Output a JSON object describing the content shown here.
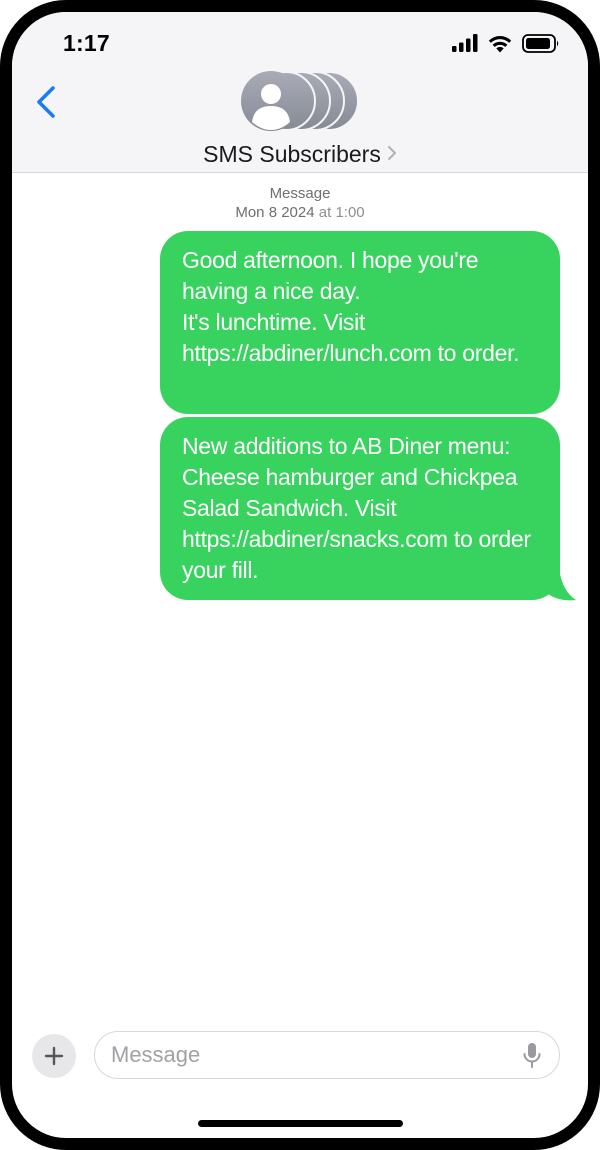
{
  "status_bar": {
    "time": "1:17",
    "icons": [
      "cellular-signal-icon",
      "wifi-icon",
      "battery-icon"
    ]
  },
  "header": {
    "back_icon": "chevron-left-icon",
    "avatar_icon": "group-avatar-icon",
    "contact_name": "SMS Subscribers",
    "contact_chevron": "chevron-right-icon"
  },
  "conversation": {
    "timestamp": {
      "label": "Message",
      "date": "Mon 8 2024",
      "at": "at",
      "time": "1:00"
    },
    "messages": [
      {
        "direction": "outgoing",
        "text": "Good afternoon. I hope you're having a nice day.\nIt's lunchtime. Visit https://abdiner/lunch.com to order."
      },
      {
        "direction": "outgoing",
        "text": "New additions to AB Diner menu: Cheese hamburger and Chickpea Salad Sandwich. Visit https://abdiner/snacks.com to order your fill."
      }
    ]
  },
  "composer": {
    "plus_icon": "plus-icon",
    "input_placeholder": "Message",
    "input_value": "",
    "mic_icon": "microphone-icon"
  },
  "colors": {
    "bubble_outgoing": "#38d35f",
    "accent": "#1a7cf5",
    "header_bg": "#f5f5f7"
  }
}
